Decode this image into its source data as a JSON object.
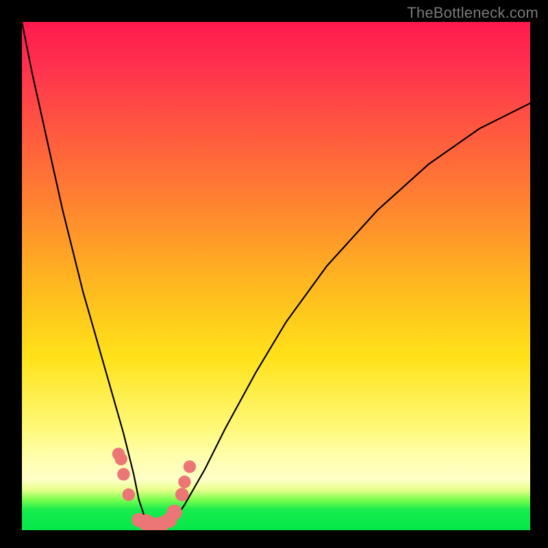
{
  "watermark": "TheBottleneck.com",
  "colors": {
    "frame": "#000000",
    "gradient_top": "#ff1a4d",
    "gradient_mid": "#ffe21a",
    "gradient_bottom": "#05e84a",
    "curve": "#000000",
    "marker": "#ec7676"
  },
  "chart_data": {
    "type": "line",
    "title": "",
    "xlabel": "",
    "ylabel": "",
    "xlim": [
      0,
      100
    ],
    "ylim": [
      0,
      100
    ],
    "grid": false,
    "legend": false,
    "series": [
      {
        "name": "curve",
        "x": [
          0,
          2,
          4,
          6,
          8,
          10,
          12,
          14,
          16,
          18,
          20,
          21,
          22,
          23,
          24,
          25,
          26,
          28,
          30,
          32,
          36,
          40,
          46,
          52,
          60,
          70,
          80,
          90,
          100
        ],
        "y": [
          100,
          90,
          81,
          72,
          63,
          55,
          47,
          40,
          33,
          26,
          19,
          15,
          11,
          6,
          3,
          1,
          0,
          0,
          2,
          5,
          12,
          20,
          31,
          41,
          52,
          63,
          72,
          79,
          84
        ]
      }
    ],
    "markers": [
      {
        "x": 19,
        "y": 15,
        "r": 1.2
      },
      {
        "x": 19.5,
        "y": 14,
        "r": 1.2
      },
      {
        "x": 20,
        "y": 11,
        "r": 1.2
      },
      {
        "x": 21,
        "y": 7,
        "r": 1.2
      },
      {
        "x": 23,
        "y": 2,
        "r": 1.4
      },
      {
        "x": 24.5,
        "y": 1.5,
        "r": 1.8
      },
      {
        "x": 26,
        "y": 1,
        "r": 1.6
      },
      {
        "x": 27.5,
        "y": 1.2,
        "r": 1.6
      },
      {
        "x": 29,
        "y": 2,
        "r": 1.6
      },
      {
        "x": 30,
        "y": 3.5,
        "r": 1.6
      },
      {
        "x": 31.5,
        "y": 7,
        "r": 1.3
      },
      {
        "x": 32,
        "y": 9.5,
        "r": 1.2
      },
      {
        "x": 33,
        "y": 12.5,
        "r": 1.2
      }
    ]
  }
}
